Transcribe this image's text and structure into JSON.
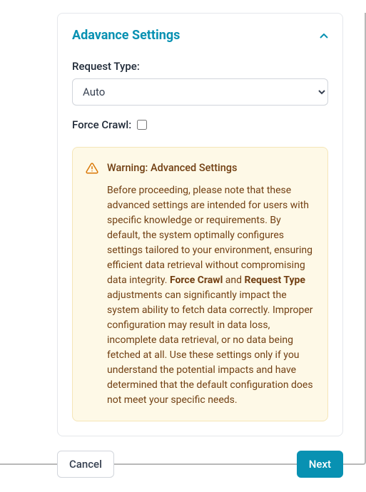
{
  "panel": {
    "title": "Adavance Settings",
    "request_type_label": "Request Type:",
    "request_type_value": "Auto",
    "force_crawl_label": "Force Crawl:",
    "force_crawl_checked": false
  },
  "warning": {
    "title": "Warning: Advanced Settings",
    "body_prefix": "Before proceeding, please note that these advanced settings are intended for users with specific knowledge or requirements. By default, the system optimally configures settings tailored to your environment, ensuring efficient data retrieval without compromising data integrity. ",
    "bold1": "Force Crawl",
    "mid1": " and ",
    "bold2": "Request Type",
    "body_suffix": " adjustments can significantly impact the system ability to fetch data correctly. Improper configuration may result in data loss, incomplete data retrieval, or no data being fetched at all. Use these settings only if you understand the potential impacts and have determined that the default configuration does not meet your specific needs."
  },
  "footer": {
    "cancel_label": "Cancel",
    "next_label": "Next"
  },
  "icons": {
    "chevron_up": "chevron-up-icon",
    "warning_triangle": "warning-triangle-icon"
  }
}
